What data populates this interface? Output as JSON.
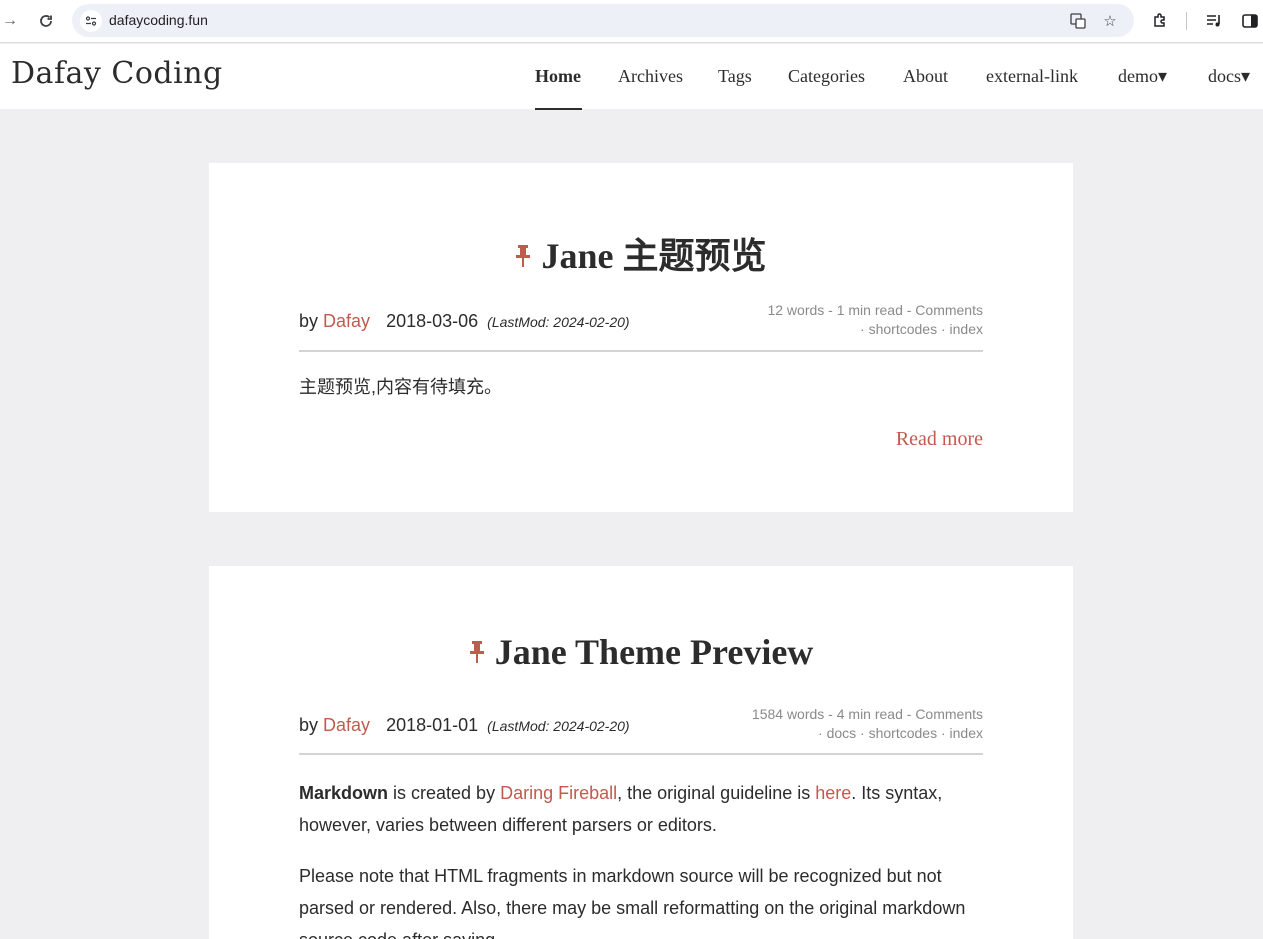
{
  "browser": {
    "url": "dafaycoding.fun"
  },
  "site": {
    "logo": "Dafay Coding",
    "menu": [
      {
        "label": "Home"
      },
      {
        "label": "Archives"
      },
      {
        "label": "Tags"
      },
      {
        "label": "Categories"
      },
      {
        "label": "About"
      },
      {
        "label": "external-link"
      },
      {
        "label": "demo▾"
      },
      {
        "label": "docs▾"
      }
    ]
  },
  "posts": [
    {
      "title": "Jane 主题预览",
      "by": "by",
      "author": "Dafay",
      "date": "2018-03-06",
      "lastmod": "(LastMod: 2024-02-20)",
      "stats": "12 words - 1 min read - Comments",
      "tags": "· shortcodes · index",
      "excerpt": "主题预览,内容有待填充。",
      "read_more": "Read more"
    },
    {
      "title": "Jane Theme Preview",
      "by": "by",
      "author": "Dafay",
      "date": "2018-01-01",
      "lastmod": "(LastMod: 2024-02-20)",
      "stats": "1584 words - 4 min read - Comments",
      "tags": "· docs · shortcodes · index",
      "p1_bold": "Markdown",
      "p1_a": " is created by ",
      "p1_link1": "Daring Fireball",
      "p1_b": ", the original guideline is ",
      "p1_link2": "here",
      "p1_c": ". Its syntax, however, varies between different parsers or editors.",
      "p2": "Please note that HTML fragments in markdown source will be recognized but not parsed or rendered. Also, there may be small reformatting on the original markdown source code after saving."
    }
  ],
  "colors": {
    "accent": "#c05b4d",
    "background": "#efeff1"
  }
}
